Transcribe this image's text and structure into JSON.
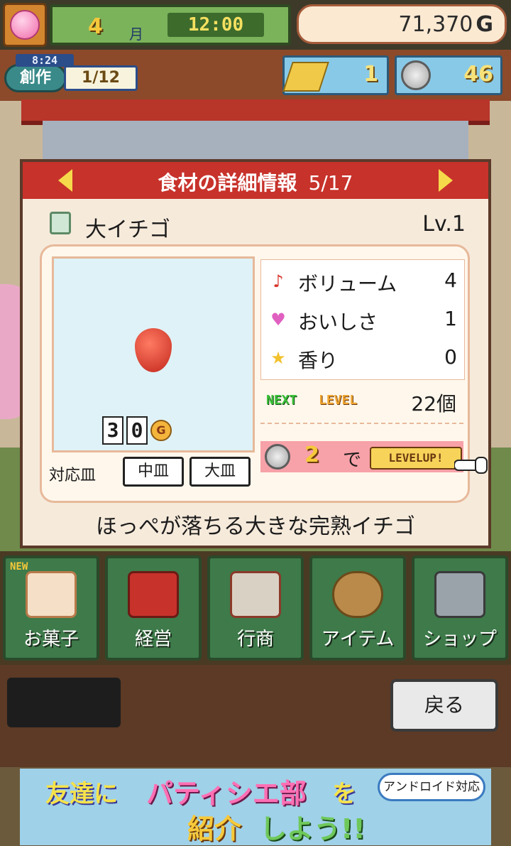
{
  "hud": {
    "month_number": "4",
    "month_label": "月",
    "time": "12:00",
    "money": "71,370",
    "money_unit": "G"
  },
  "creation": {
    "clock": "8:24",
    "label": "創作",
    "count": "1/12"
  },
  "resources": {
    "gold_count": "1",
    "medal_count": "46"
  },
  "dialog": {
    "title": "食材の詳細情報",
    "page": "5/17",
    "item_name": "大イチゴ",
    "item_level": "Lv.1",
    "price_digits": [
      "3",
      "0"
    ],
    "price_unit": "G",
    "plates_label": "対応皿",
    "plates": [
      "中皿",
      "大皿"
    ],
    "stats": [
      {
        "icon": "music-note-icon",
        "glyph": "♪",
        "color": "#d9342b",
        "label": "ボリューム",
        "value": "4"
      },
      {
        "icon": "heart-icon",
        "glyph": "♥",
        "color": "#e060c0",
        "label": "おいしさ",
        "value": "1"
      },
      {
        "icon": "star-icon",
        "glyph": "★",
        "color": "#f2c22c",
        "label": "香り",
        "value": "0"
      }
    ],
    "next_badge": "NEXT",
    "level_badge": "LEVEL",
    "next_count": "22個",
    "levelup_cost": "2",
    "levelup_de": "で",
    "levelup_button": "LEVELUP!",
    "description": "ほっぺが落ちる大きな完熟イチゴ"
  },
  "nav": {
    "new_badge": "NEW",
    "items": [
      "お菓子",
      "経営",
      "行商",
      "アイテム",
      "ショップ"
    ]
  },
  "lower": {
    "back_label": "戻る"
  },
  "ad": {
    "line1_a": "友達に",
    "line1_b": "パティシエ部",
    "line1_c": "を",
    "line2_a": "紹介",
    "line2_b": "しよう!!",
    "badge": "アンドロイド対応"
  },
  "colors": {
    "header_red": "#c7322b",
    "panel_cream": "#f6eadb",
    "nav_green": "#3e7a4a"
  }
}
